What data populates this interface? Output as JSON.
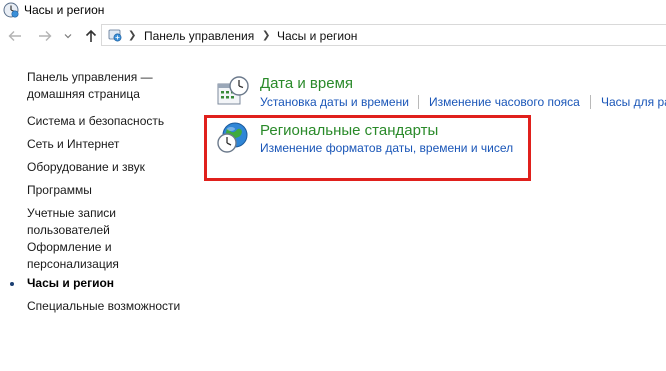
{
  "window": {
    "title": "Часы и регион"
  },
  "address_bar": {
    "breadcrumbs": [
      "Панель управления",
      "Часы и регион"
    ]
  },
  "sidebar": {
    "items": [
      {
        "label_line1": "Панель управления —",
        "label_line2": "домашняя страница",
        "active": false
      },
      {
        "label": "Система и безопасность",
        "active": false
      },
      {
        "label": "Сеть и Интернет",
        "active": false
      },
      {
        "label": "Оборудование и звук",
        "active": false
      },
      {
        "label": "Программы",
        "active": false
      },
      {
        "label_line1": "Учетные записи",
        "label_line2": "пользователей",
        "active": false
      },
      {
        "label_line1": "Оформление и",
        "label_line2": "персонализация",
        "active": false
      },
      {
        "label": "Часы и регион",
        "active": true
      },
      {
        "label": "Специальные возможности",
        "active": false
      }
    ]
  },
  "main": {
    "categories": [
      {
        "title": "Дата и время",
        "icon": "calendar-clock-icon",
        "links": [
          "Установка даты и времени",
          "Изменение часового пояса",
          "Часы для ра"
        ]
      },
      {
        "title": "Региональные стандарты",
        "icon": "globe-clock-icon",
        "links": [
          "Изменение форматов даты, времени и чисел"
        ]
      }
    ]
  },
  "colors": {
    "category_title": "#2a8a2a",
    "link": "#1a56b8",
    "highlight": "#e0201c"
  }
}
